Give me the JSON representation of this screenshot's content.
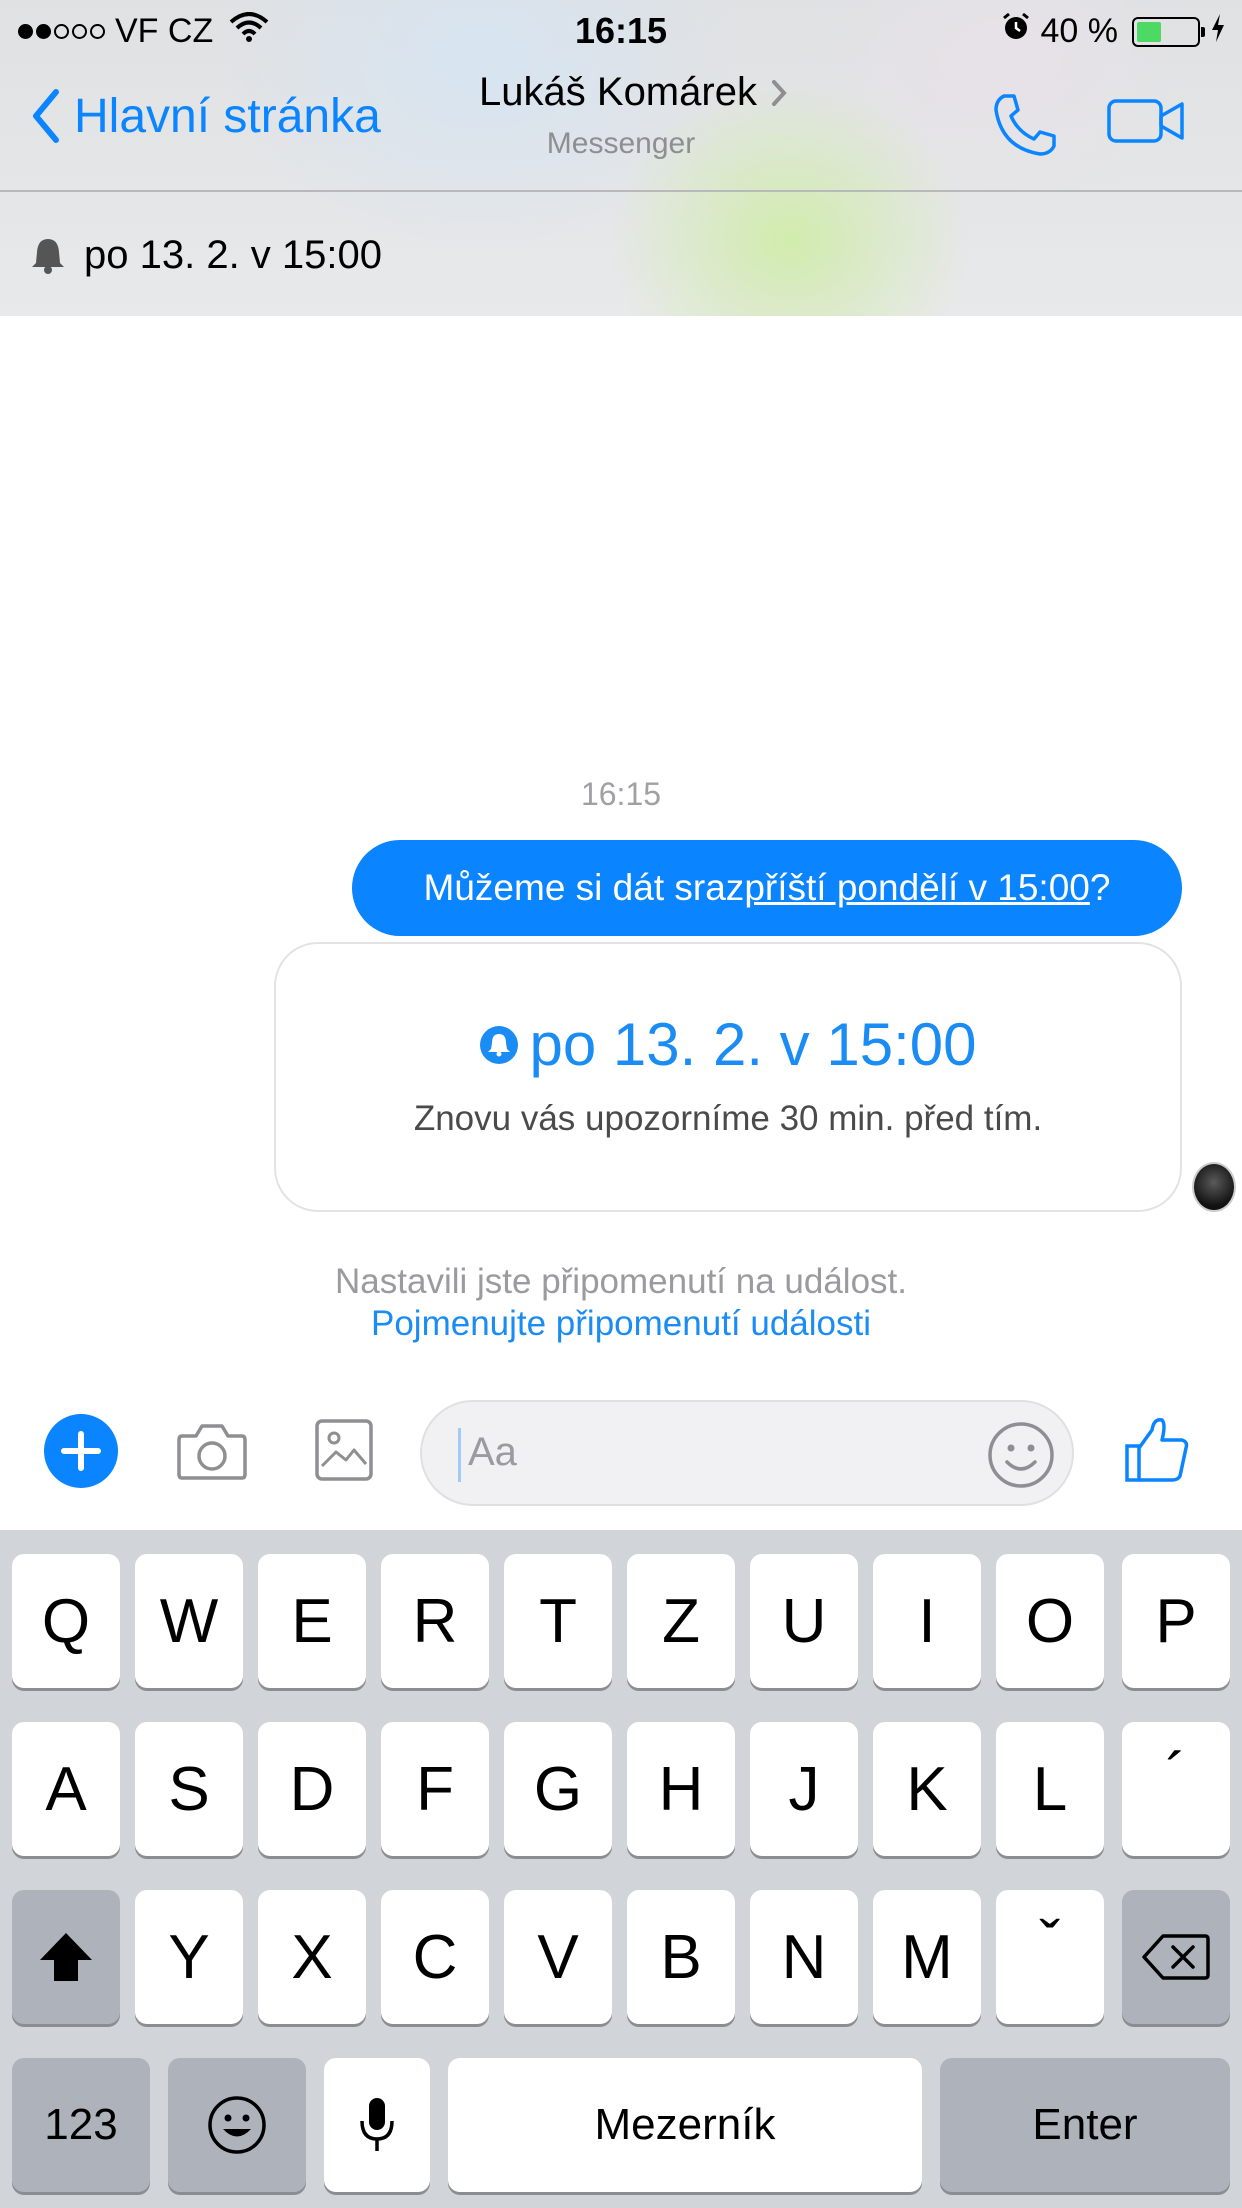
{
  "status_bar": {
    "carrier": "VF CZ",
    "signal_bars_filled": 2,
    "signal_bars_total": 5,
    "time": "16:15",
    "battery_percent": "40 %",
    "battery_level": 0.4
  },
  "nav": {
    "back_label": "Hlavní stránka",
    "contact_name": "Lukáš Komárek",
    "contact_subtitle": "Messenger"
  },
  "reminder_bar": {
    "text": "po 13. 2. v 15:00"
  },
  "chat": {
    "timestamp": "16:15",
    "message": {
      "prefix": "Můžeme si dát sraz ",
      "link": "příští pondělí v 15:00",
      "suffix": "?"
    },
    "event_card": {
      "title": "po 13. 2. v 15:00",
      "description": "Znovu vás upozorníme 30 min. před tím."
    },
    "notice": "Nastavili jste připomenutí na událost.",
    "notice_link": "Pojmenujte připomenutí události"
  },
  "composer": {
    "placeholder": "Aa"
  },
  "keyboard": {
    "row1": [
      "Q",
      "W",
      "E",
      "R",
      "T",
      "Z",
      "U",
      "I",
      "O",
      "P"
    ],
    "row2": [
      "A",
      "S",
      "D",
      "F",
      "G",
      "H",
      "J",
      "K",
      "L",
      "´"
    ],
    "row3": [
      "Y",
      "X",
      "C",
      "V",
      "B",
      "N",
      "M",
      "ˇ"
    ],
    "numbers_key": "123",
    "space_key": "Mezerník",
    "enter_key": "Enter"
  },
  "colors": {
    "accent": "#0a84ff",
    "battery": "#4cd964",
    "keyboard_bg": "#d1d4d9"
  }
}
